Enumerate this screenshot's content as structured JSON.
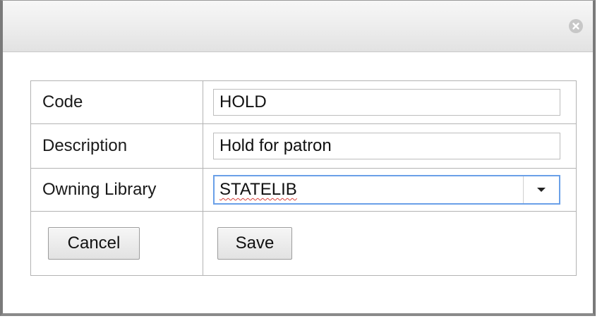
{
  "dialog": {
    "close_icon": "close-circle-icon"
  },
  "form": {
    "code": {
      "label": "Code",
      "value": "HOLD"
    },
    "description": {
      "label": "Description",
      "value": "Hold for patron"
    },
    "owning_library": {
      "label": "Owning Library",
      "selected": "STATELIB"
    }
  },
  "buttons": {
    "cancel_label": "Cancel",
    "save_label": "Save"
  }
}
